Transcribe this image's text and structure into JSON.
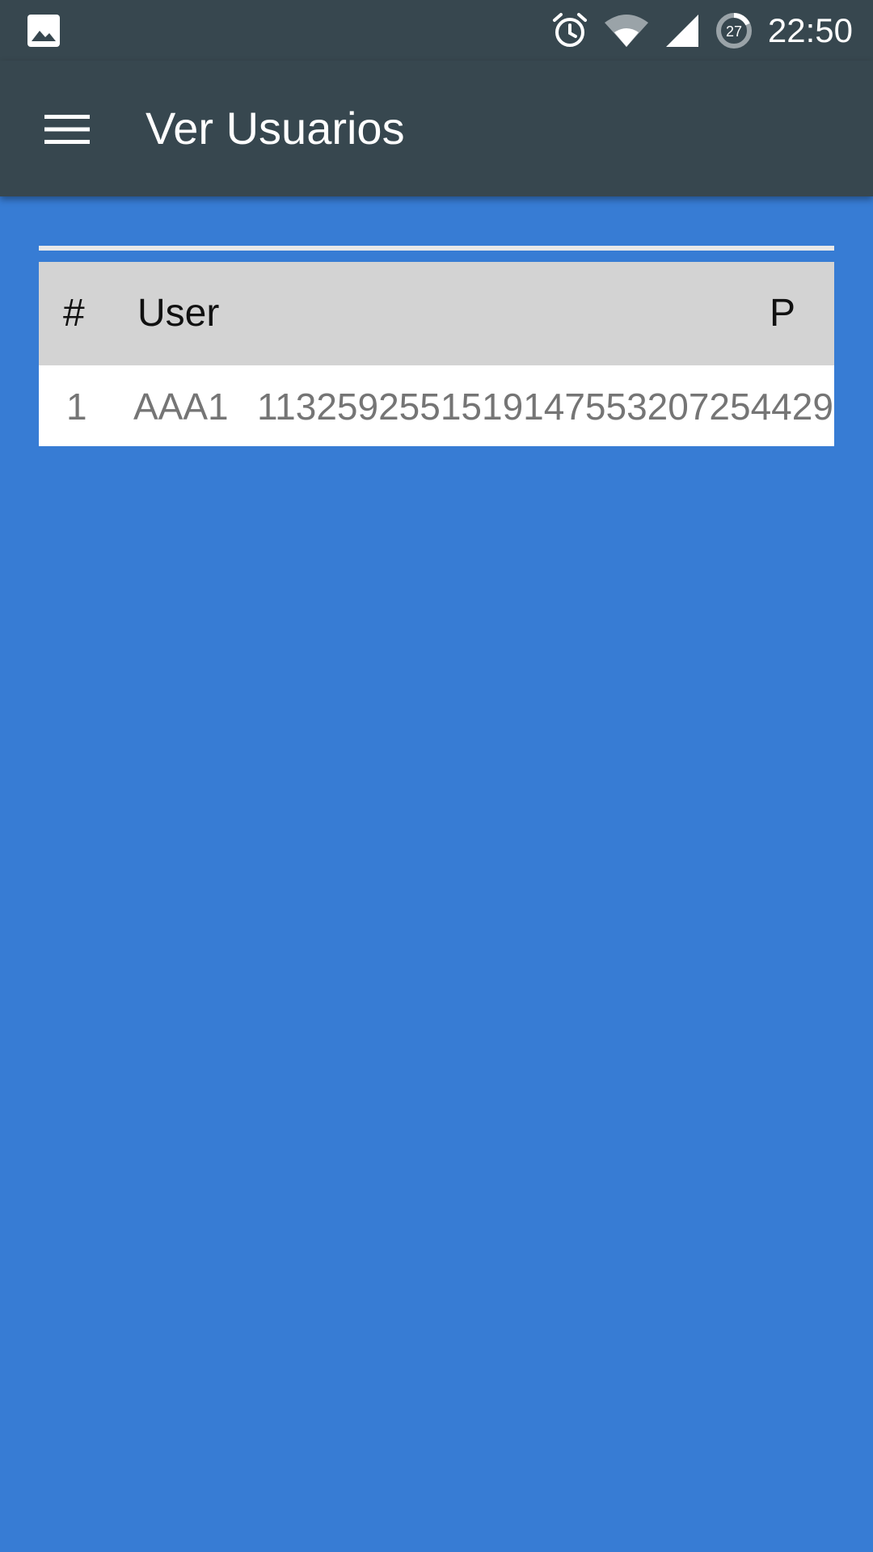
{
  "status_bar": {
    "time": "22:50",
    "icons": [
      "image-icon",
      "alarm-icon",
      "wifi-icon",
      "cell-signal-icon",
      "data-saver-icon"
    ],
    "badge_value": "27"
  },
  "app_bar": {
    "title": "Ver Usuarios",
    "menu_icon": "hamburger-menu-icon"
  },
  "table": {
    "headers": [
      "#",
      "User",
      "P"
    ],
    "rows": [
      {
        "index": "1",
        "user": "AAA1",
        "password": "1132592551519147553207254429"
      }
    ]
  },
  "colors": {
    "background": "#377CD4",
    "app_bar": "#37474F",
    "header_row": "#D3D3D3",
    "data_row": "#FFFFFF"
  }
}
